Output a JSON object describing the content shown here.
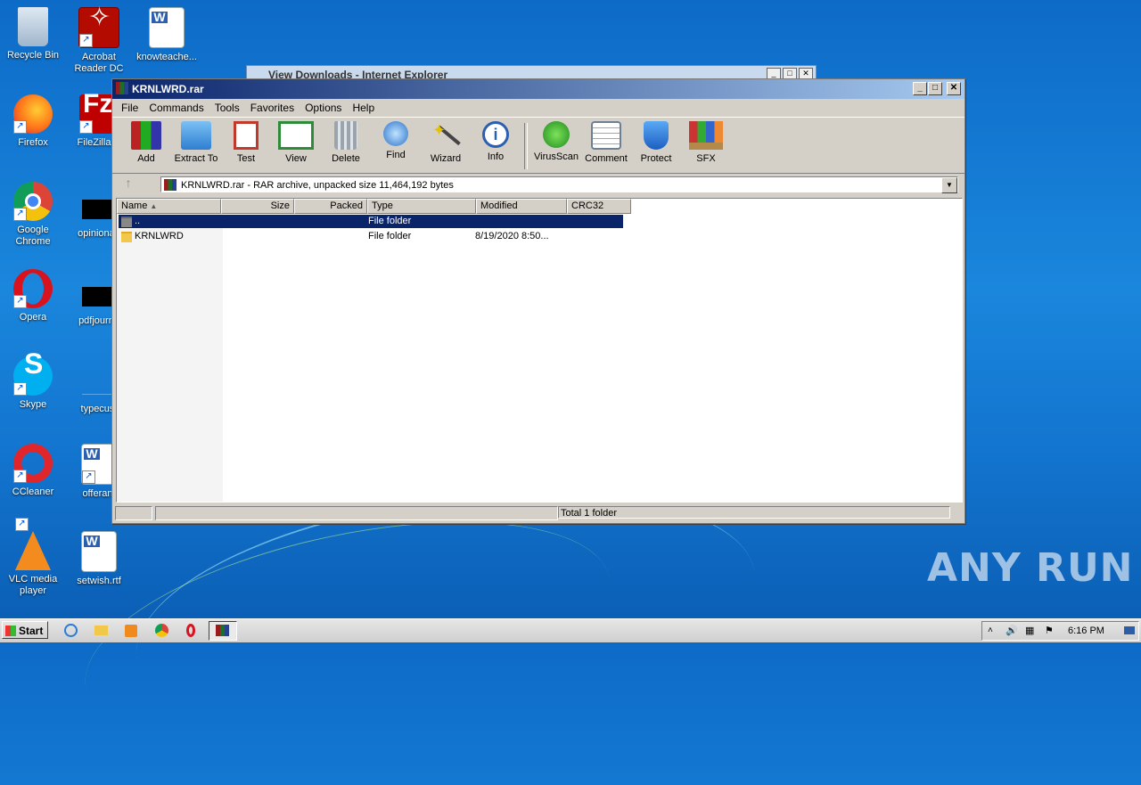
{
  "desktop": {
    "icons": [
      {
        "label": "Recycle Bin"
      },
      {
        "label": "Acrobat Reader DC"
      },
      {
        "label": "knowteache..."
      },
      {
        "label": "Firefox"
      },
      {
        "label": "FileZilla C"
      },
      {
        "label": "Google Chrome"
      },
      {
        "label": "opinionau"
      },
      {
        "label": "Opera"
      },
      {
        "label": "pdfjourna"
      },
      {
        "label": "Skype"
      },
      {
        "label": "typecust"
      },
      {
        "label": "CCleaner"
      },
      {
        "label": "offerant"
      },
      {
        "label": "VLC media player"
      },
      {
        "label": "setwish.rtf"
      }
    ],
    "watermark": "ANY RUN"
  },
  "background_window": {
    "title": "View Downloads - Internet Explorer"
  },
  "winrar": {
    "title": "KRNLWRD.rar",
    "menu": [
      "File",
      "Commands",
      "Tools",
      "Favorites",
      "Options",
      "Help"
    ],
    "toolbar": [
      "Add",
      "Extract To",
      "Test",
      "View",
      "Delete",
      "Find",
      "Wizard",
      "Info",
      "VirusScan",
      "Comment",
      "Protect",
      "SFX"
    ],
    "address": "KRNLWRD.rar - RAR archive, unpacked size 11,464,192 bytes",
    "columns": [
      "Name",
      "Size",
      "Packed",
      "Type",
      "Modified",
      "CRC32"
    ],
    "rows": [
      {
        "name": "..",
        "size": "",
        "packed": "",
        "type": "File folder",
        "modified": "",
        "crc": ""
      },
      {
        "name": "KRNLWRD",
        "size": "",
        "packed": "",
        "type": "File folder",
        "modified": "8/19/2020 8:50...",
        "crc": ""
      }
    ],
    "status": "Total 1 folder"
  },
  "taskbar": {
    "start": "Start",
    "clock": "6:16 PM"
  }
}
